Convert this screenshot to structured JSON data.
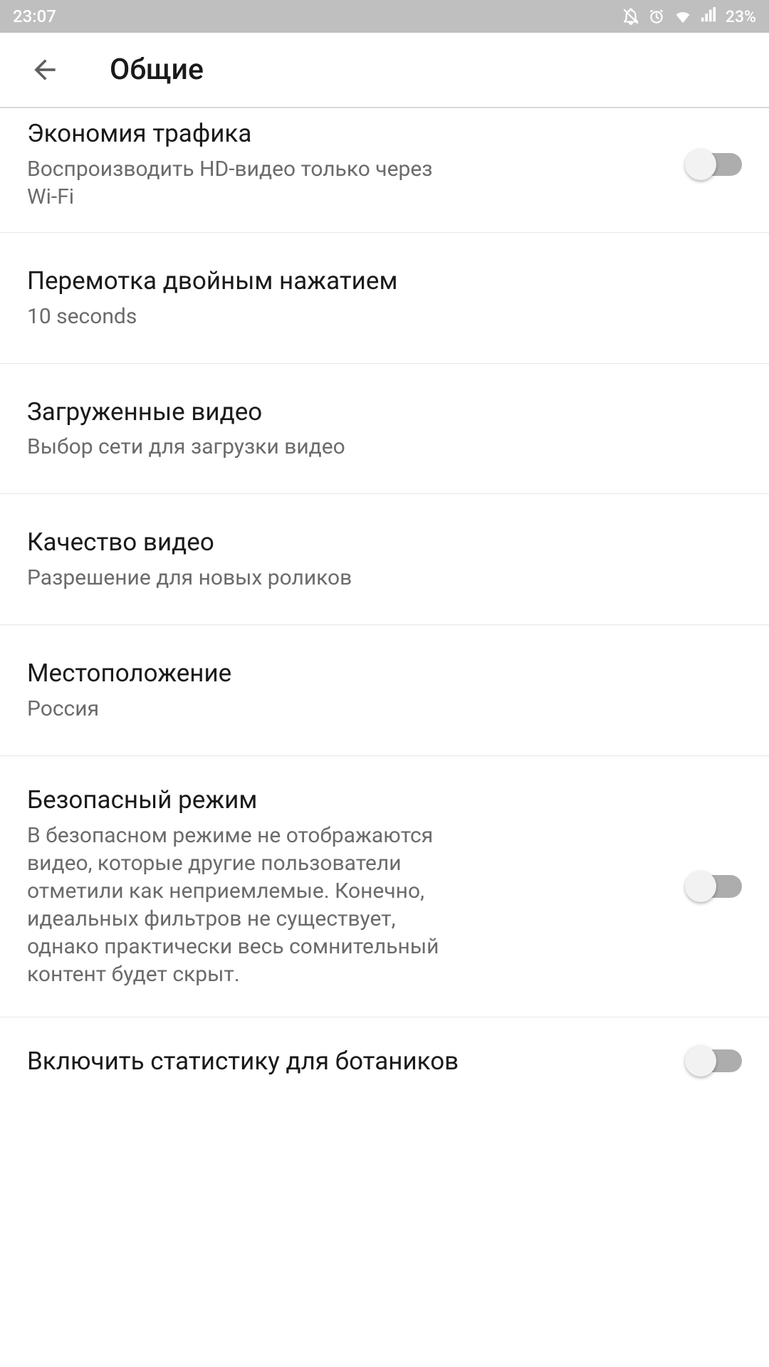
{
  "status": {
    "time": "23:07",
    "battery": "23%"
  },
  "header": {
    "title": "Общие"
  },
  "settings": {
    "data_saver": {
      "title": "Экономия трафика",
      "subtitle": "Воспроизводить HD-видео только через Wi-Fi",
      "toggle": false
    },
    "double_tap_seek": {
      "title": "Перемотка двойным нажатием",
      "subtitle": "10 seconds"
    },
    "downloads": {
      "title": "Загруженные видео",
      "subtitle": "Выбор сети для загрузки видео"
    },
    "video_quality": {
      "title": "Качество видео",
      "subtitle": "Разрешение для новых роликов"
    },
    "location": {
      "title": "Местоположение",
      "subtitle": "Россия"
    },
    "restricted_mode": {
      "title": "Безопасный режим",
      "subtitle": "В безопасном режиме не отображаются видео, которые другие пользователи отметили как неприемлемые. Конечно, идеальных фильтров не существует, однако практически весь сомнительный контент будет скрыт.",
      "toggle": false
    },
    "stats_for_nerds": {
      "title": "Включить статистику для ботаников",
      "toggle": false
    }
  }
}
